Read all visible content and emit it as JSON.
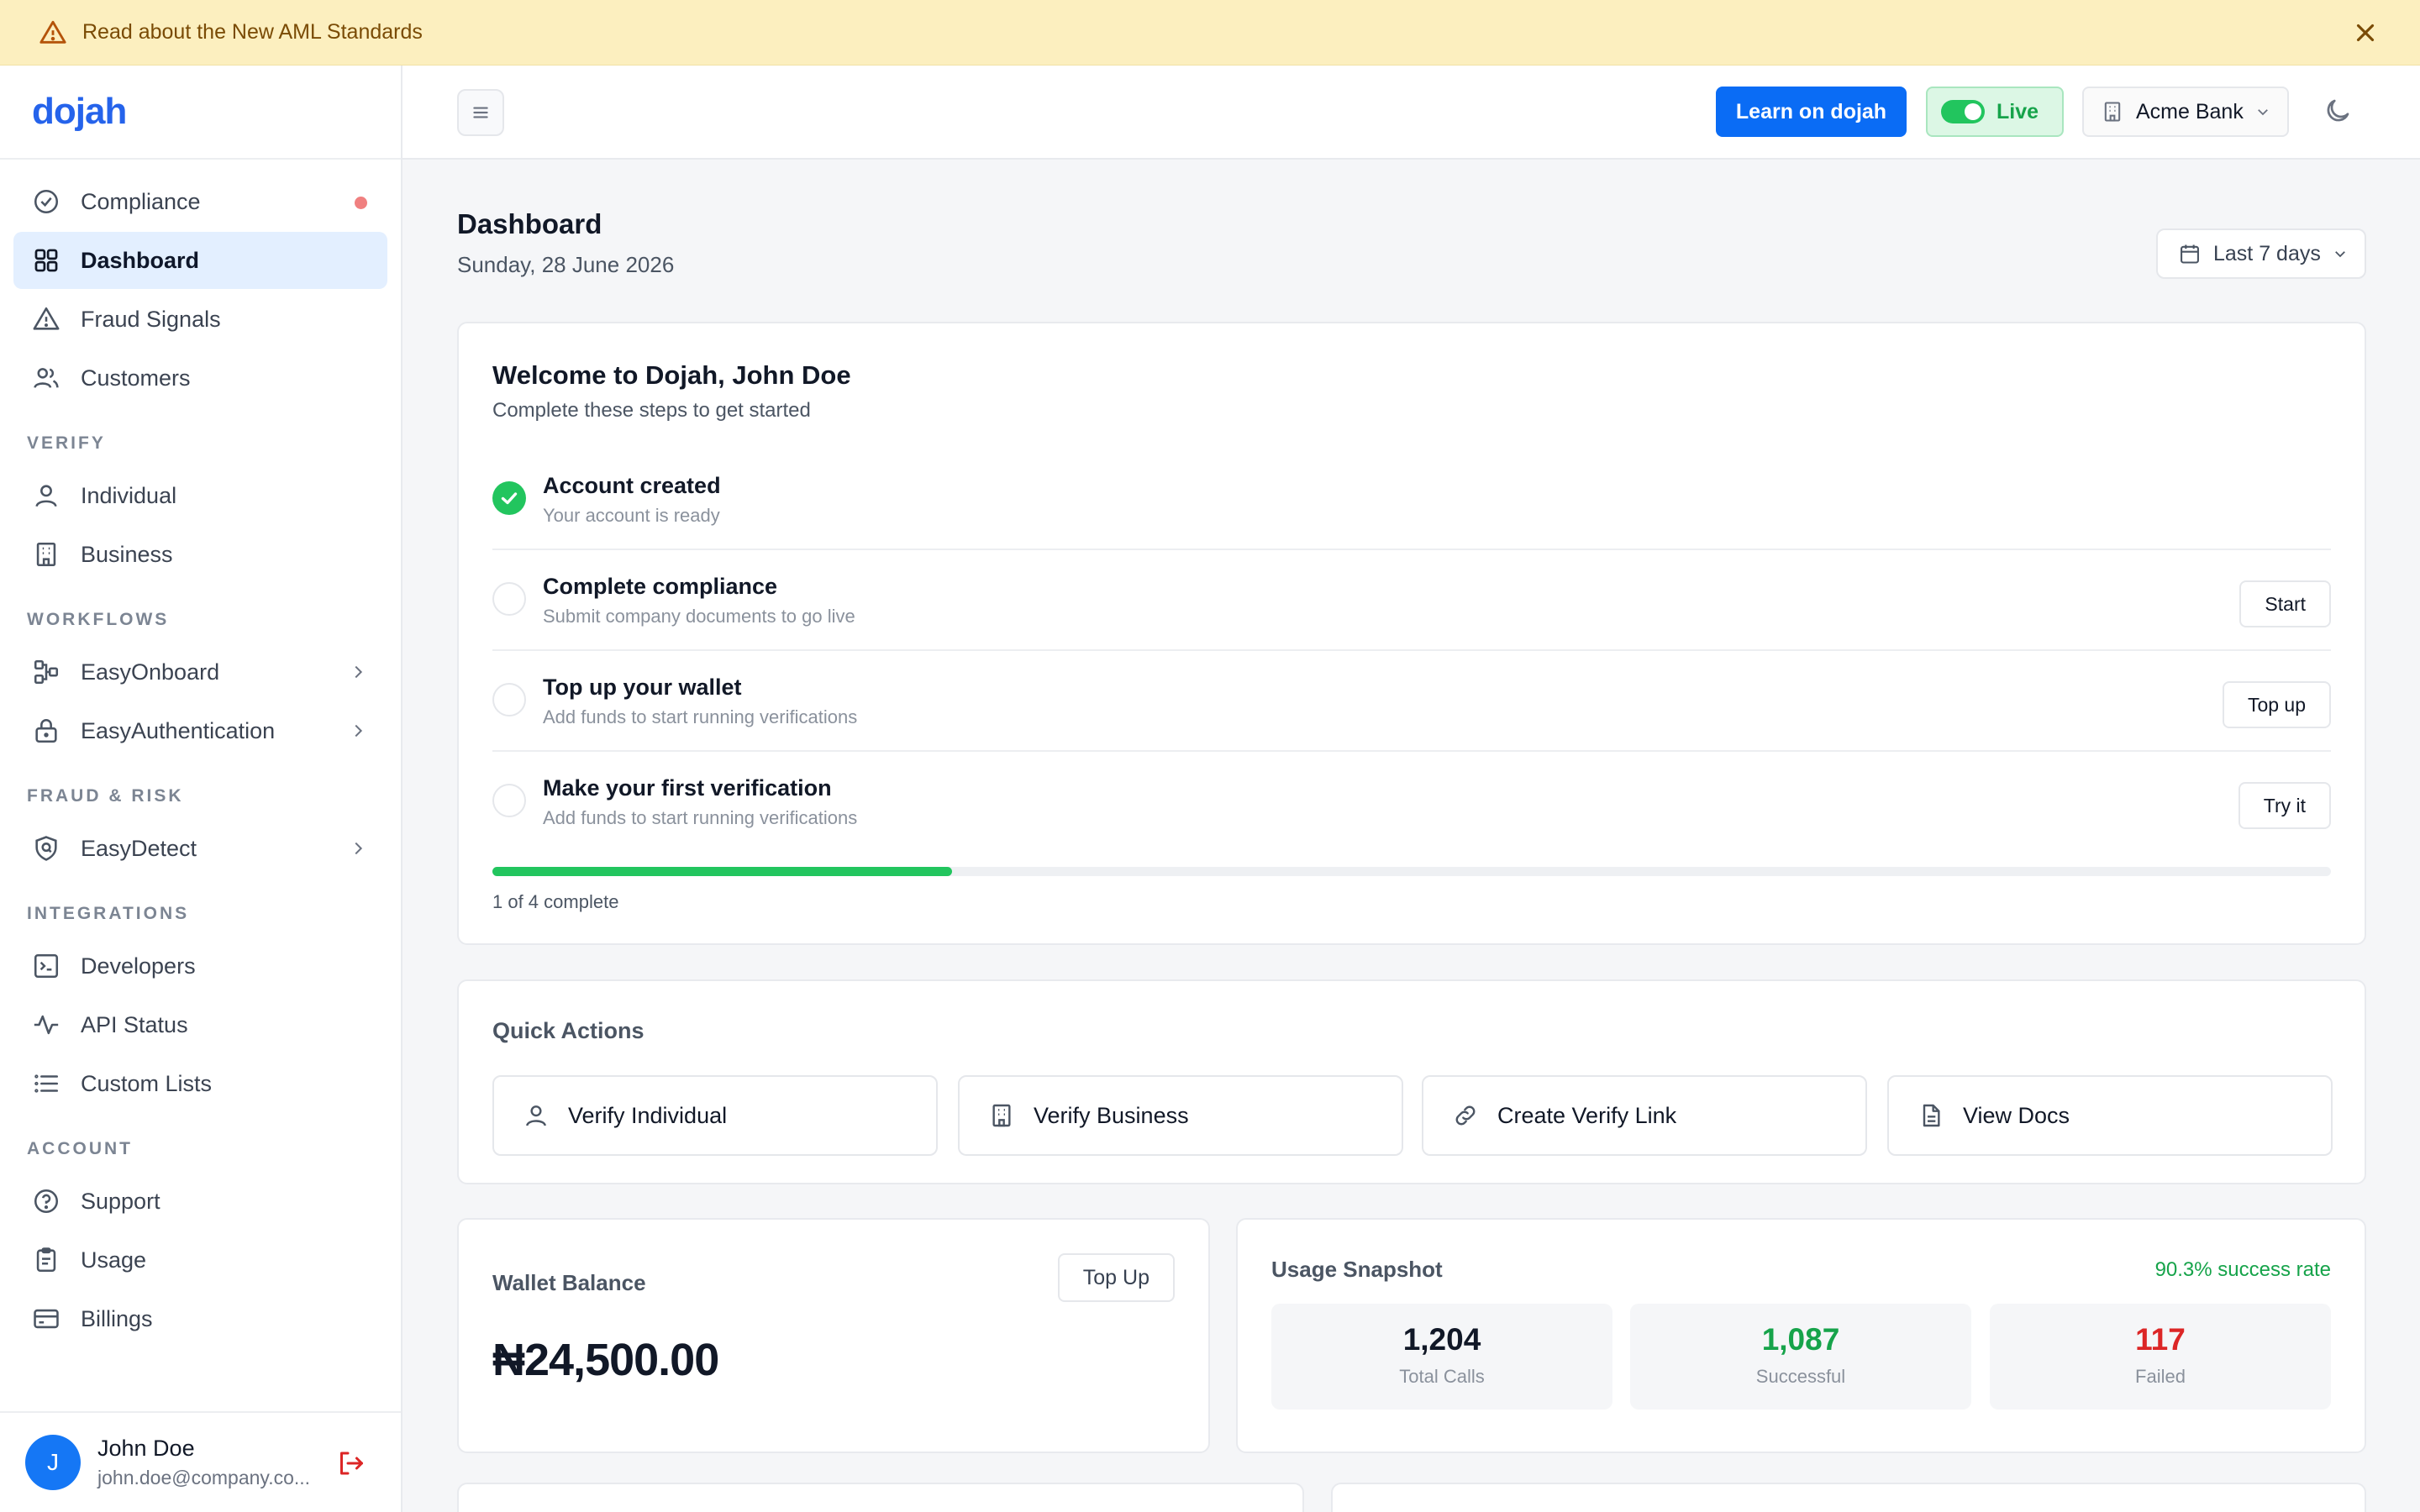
{
  "banner": {
    "text": "Read about the New AML Standards"
  },
  "brand": {
    "logo": "dojah"
  },
  "sidebar": {
    "top_items": [
      {
        "label": "Compliance",
        "icon": "check-circle-icon",
        "notification": true
      },
      {
        "label": "Dashboard",
        "icon": "grid-icon",
        "active": true
      },
      {
        "label": "Fraud Signals",
        "icon": "warning-icon"
      },
      {
        "label": "Customers",
        "icon": "users-icon"
      }
    ],
    "sections": [
      {
        "title": "VERIFY",
        "items": [
          {
            "label": "Individual",
            "icon": "user-icon"
          },
          {
            "label": "Business",
            "icon": "building-icon"
          }
        ]
      },
      {
        "title": "WORKFLOWS",
        "items": [
          {
            "label": "EasyOnboard",
            "icon": "flow-icon",
            "expandable": true
          },
          {
            "label": "EasyAuthentication",
            "icon": "lock-icon",
            "expandable": true
          }
        ]
      },
      {
        "title": "FRAUD & RISK",
        "items": [
          {
            "label": "EasyDetect",
            "icon": "shield-icon",
            "expandable": true
          }
        ]
      },
      {
        "title": "INTEGRATIONS",
        "items": [
          {
            "label": "Developers",
            "icon": "terminal-icon"
          },
          {
            "label": "API Status",
            "icon": "pulse-icon"
          },
          {
            "label": "Custom Lists",
            "icon": "list-icon"
          }
        ]
      },
      {
        "title": "ACCOUNT",
        "items": [
          {
            "label": "Support",
            "icon": "help-icon"
          },
          {
            "label": "Usage",
            "icon": "clipboard-icon"
          },
          {
            "label": "Billings",
            "icon": "card-icon"
          }
        ]
      }
    ],
    "user": {
      "initial": "J",
      "name": "John Doe",
      "email": "john.doe@company.co..."
    }
  },
  "topbar": {
    "learn_label": "Learn on dojah",
    "live_label": "Live",
    "org_label": "Acme Bank"
  },
  "page": {
    "title": "Dashboard",
    "date": "Sunday, 28 June 2026",
    "range_label": "Last 7 days"
  },
  "welcome": {
    "title": "Welcome to Dojah, John Doe",
    "subtitle": "Complete these steps to get started",
    "steps": [
      {
        "title": "Account created",
        "desc": "Your account is ready",
        "done": true,
        "action": ""
      },
      {
        "title": "Complete compliance",
        "desc": "Submit company documents to go live",
        "done": false,
        "action": "Start"
      },
      {
        "title": "Top up your wallet",
        "desc": "Add funds to start running verifications",
        "done": false,
        "action": "Top up"
      },
      {
        "title": "Make your first verification",
        "desc": "Add funds to start running verifications",
        "done": false,
        "action": "Try it"
      }
    ],
    "progress": 0.25,
    "progress_label": "1 of 4 complete"
  },
  "quick_actions": {
    "title": "Quick Actions",
    "items": [
      {
        "label": "Verify Individual",
        "icon": "user-icon"
      },
      {
        "label": "Verify Business",
        "icon": "building-icon"
      },
      {
        "label": "Create Verify Link",
        "icon": "link-icon"
      },
      {
        "label": "View Docs",
        "icon": "document-icon"
      }
    ]
  },
  "wallet": {
    "title": "Wallet Balance",
    "button": "Top Up",
    "amount": "₦24,500.00"
  },
  "usage": {
    "title": "Usage Snapshot",
    "rate": "90.3% success rate",
    "stats": [
      {
        "value": "1,204",
        "label": "Total Calls",
        "color": "#111827"
      },
      {
        "value": "1,087",
        "label": "Successful",
        "color": "#16a34a"
      },
      {
        "value": "117",
        "label": "Failed",
        "color": "#dc2626"
      }
    ]
  },
  "colors": {
    "accent": "#0a6cf5",
    "success": "#22c55e",
    "danger": "#dc2626",
    "banner": "#fcefbf"
  }
}
